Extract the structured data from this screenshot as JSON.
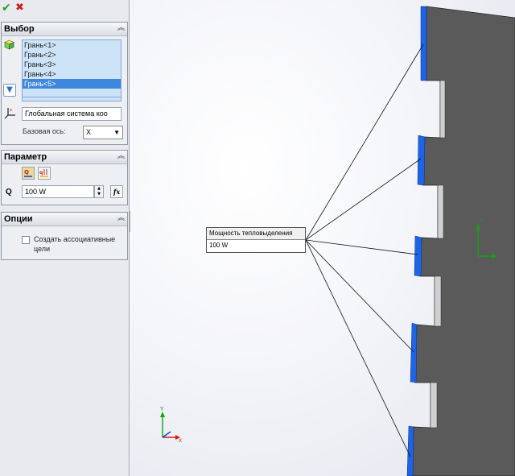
{
  "toolbar": {
    "ok_icon": "check-icon",
    "cancel_icon": "x-icon",
    "ok_color": "#2a9a2a",
    "cancel_color": "#d02020"
  },
  "selection": {
    "title": "Выбор",
    "faces": [
      "Грань<1>",
      "Грань<2>",
      "Грань<3>",
      "Грань<4>",
      "Грань<5>"
    ],
    "active_index": 4,
    "coord_system": "Глобальная система коо",
    "base_axis_label": "Базовая ось:",
    "base_axis_value": "X"
  },
  "parameter": {
    "title": "Параметр",
    "q_label": "Q",
    "q_value": "100 W"
  },
  "options": {
    "title": "Опции",
    "associative_label": "Создать ассоциативные цели"
  },
  "viewport": {
    "callout_title": "Мощность тепловыделения",
    "callout_value": "100 W",
    "face_color": "#1e64e6",
    "body_color": "#555555"
  }
}
